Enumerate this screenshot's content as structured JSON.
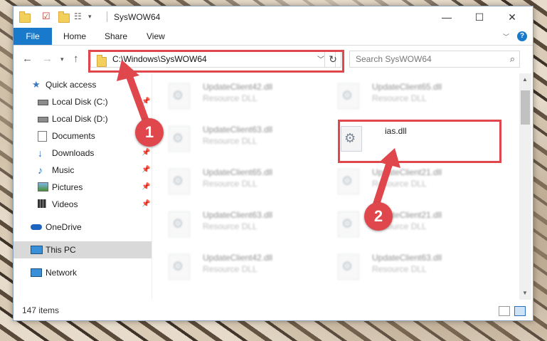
{
  "window": {
    "title": "SysWOW64",
    "controls": {
      "minimize": "—",
      "maximize": "☐",
      "close": "✕"
    }
  },
  "ribbon": {
    "tabs": [
      "File",
      "Home",
      "Share",
      "View"
    ],
    "help": "?"
  },
  "address_bar": {
    "path": "C:\\Windows\\SysWOW64",
    "search_placeholder": "Search SysWOW64"
  },
  "sidebar": {
    "items": [
      {
        "label": "Quick access",
        "icon": "star-icon",
        "pinned": false
      },
      {
        "label": "Local Disk (C:)",
        "icon": "drive-icon",
        "pinned": true
      },
      {
        "label": "Local Disk (D:)",
        "icon": "drive-icon",
        "pinned": false
      },
      {
        "label": "Documents",
        "icon": "documents-icon",
        "pinned": true
      },
      {
        "label": "Downloads",
        "icon": "download-icon",
        "pinned": true
      },
      {
        "label": "Music",
        "icon": "music-icon",
        "pinned": true
      },
      {
        "label": "Pictures",
        "icon": "pictures-icon",
        "pinned": true
      },
      {
        "label": "Videos",
        "icon": "videos-icon",
        "pinned": true
      },
      {
        "label": "OneDrive",
        "icon": "cloud-icon",
        "pinned": false
      },
      {
        "label": "This PC",
        "icon": "pc-icon",
        "pinned": false,
        "selected": true
      },
      {
        "label": "Network",
        "icon": "network-icon",
        "pinned": false
      }
    ]
  },
  "files": [
    {
      "name": "UpdateClient42.dll",
      "type": "Resource DLL",
      "blurred": true
    },
    {
      "name": "UpdateClient65.dll",
      "type": "Resource DLL",
      "blurred": true
    },
    {
      "name": "UpdateClient63.dll",
      "type": "Resource DLL",
      "blurred": true
    },
    {
      "name": "ias.dll",
      "type": "",
      "blurred": false,
      "highlighted": true
    },
    {
      "name": "UpdateClient65.dll",
      "type": "Resource DLL",
      "blurred": true
    },
    {
      "name": "UpdateClient21.dll",
      "type": "Resource DLL",
      "blurred": true
    },
    {
      "name": "UpdateClient63.dll",
      "type": "Resource DLL",
      "blurred": true
    },
    {
      "name": "UpdateClient21.dll",
      "type": "Resource DLL",
      "blurred": true
    },
    {
      "name": "UpdateClient42.dll",
      "type": "Resource DLL",
      "blurred": true
    },
    {
      "name": "UpdateClient63.dll",
      "type": "Resource DLL",
      "blurred": true
    }
  ],
  "status": {
    "item_count": "147 items"
  },
  "annotations": {
    "step1": "1",
    "step2": "2",
    "color": "#e0474c"
  },
  "colors": {
    "accent": "#1979ca",
    "highlight_selection": "#d9d9d9"
  }
}
